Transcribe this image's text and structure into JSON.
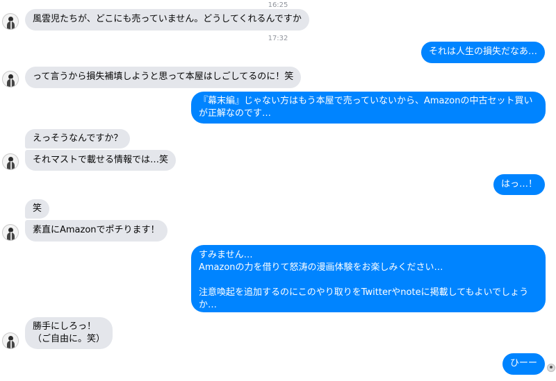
{
  "timestamps": [
    "16:25",
    "17:32"
  ],
  "messages": [
    {
      "text": "風雲児たちが、どこにも売っていません。どうしてくれるんですか"
    },
    {
      "text": "それは人生の損失だなあ…"
    },
    {
      "text": "って言うから損失補填しようと思って本屋はしごしてるのに！笑"
    },
    {
      "text": "『幕末編』じゃない方はもう本屋で売っていないから、Amazonの中古セット買いが正解なのです…"
    },
    {
      "text": "えっそうなんですか？"
    },
    {
      "text": "それマストで載せる情報では…笑"
    },
    {
      "text": "はっ…！"
    },
    {
      "text": "笑"
    },
    {
      "text": "素直にAmazonでポチります！"
    },
    {
      "text": "すみません…\nAmazonの力を借りて怒涛の漫画体験をお楽しみください…\n\n注意喚起を追加するのにこのやり取りをTwitterやnoteに掲載してもよいでしょうか…"
    },
    {
      "text": "勝手にしろっ！\n（ご自由に。笑）"
    },
    {
      "text": "ひーー"
    }
  ],
  "icons": {
    "avatar": "contact-avatar-icon",
    "seen": "seen-indicator-icon"
  }
}
